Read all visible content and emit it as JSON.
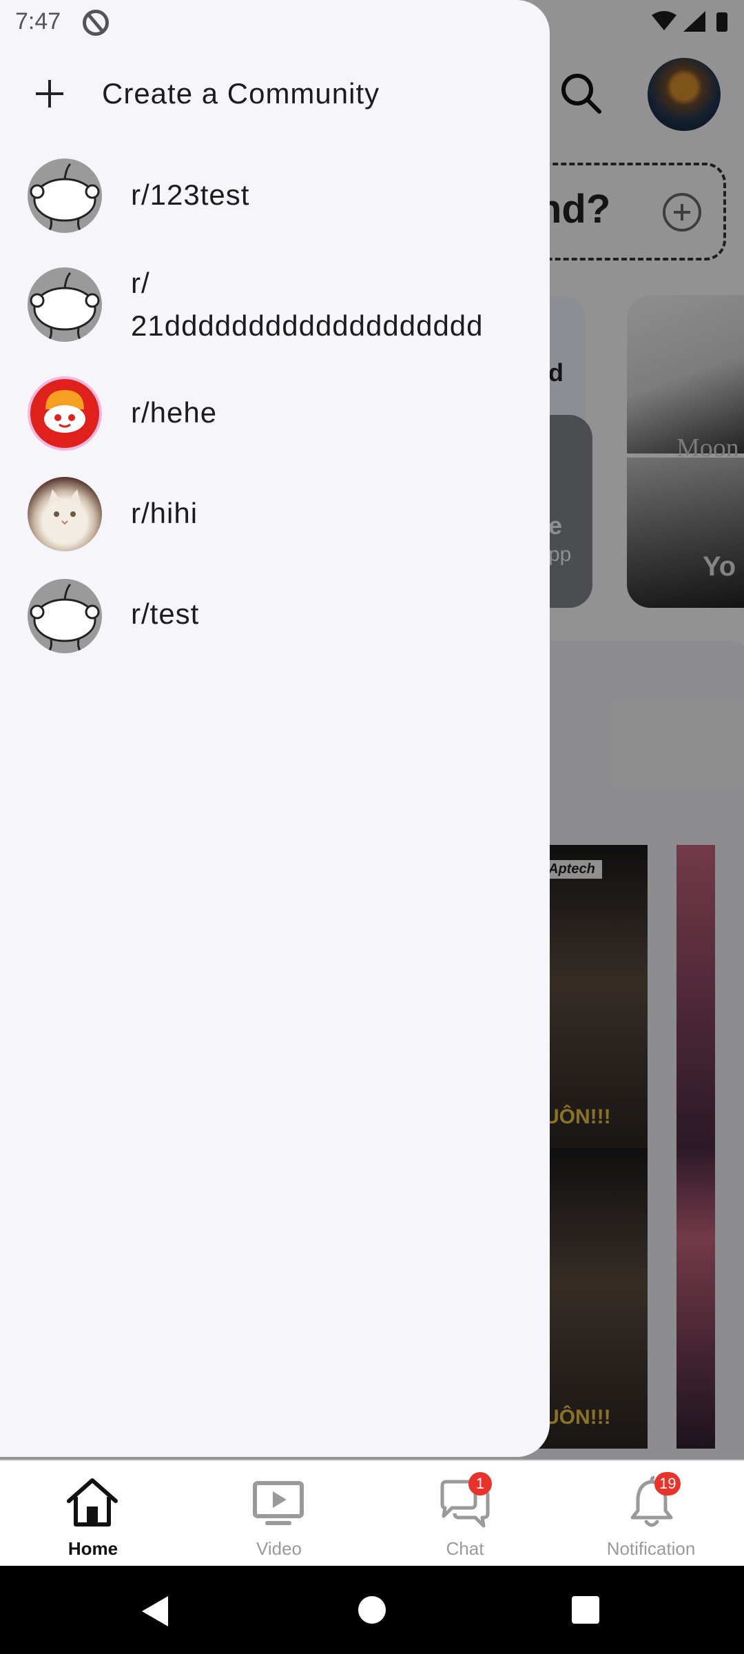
{
  "status_bar": {
    "time": "7:47"
  },
  "drawer": {
    "create_label": "Create a Community",
    "communities": [
      {
        "name": "r/123test",
        "avatar": "default-snoo"
      },
      {
        "name": "r/\n21ddddddddddddddddddd",
        "avatar": "default-snoo"
      },
      {
        "name": "r/hehe",
        "avatar": "orange-snoo"
      },
      {
        "name": "r/hihi",
        "avatar": "white-cat"
      },
      {
        "name": "r/test",
        "avatar": "default-snoo"
      }
    ]
  },
  "background": {
    "ask_text": "nd?",
    "card_text_1": "d",
    "card_text_2": "e",
    "card_text_3": "pp",
    "card_text_4": "Moon",
    "card_text_5": "Yo",
    "video_text": "UÔN!!!",
    "video_brand": "Aptech"
  },
  "bottom_nav": {
    "items": [
      {
        "label": "Home",
        "icon": "home-icon",
        "active": true
      },
      {
        "label": "Video",
        "icon": "video-icon",
        "active": false
      },
      {
        "label": "Chat",
        "icon": "chat-icon",
        "active": false,
        "badge": "1"
      },
      {
        "label": "Notification",
        "icon": "bell-icon",
        "active": false,
        "badge": "19"
      }
    ]
  },
  "colors": {
    "badge": "#e8322a",
    "active": "#111111",
    "inactive": "#9a9a9a"
  }
}
